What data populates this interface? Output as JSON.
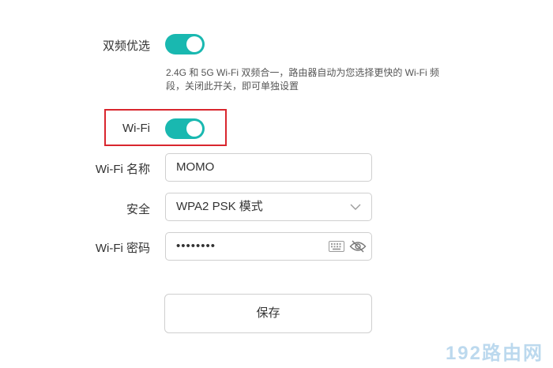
{
  "dual_band": {
    "label": "双频优选",
    "enabled": true,
    "hint": "2.4G 和 5G Wi-Fi 双频合一，路由器自动为您选择更快的 Wi-Fi 频段，关闭此开关，即可单独设置"
  },
  "wifi": {
    "label": "Wi-Fi",
    "enabled": true
  },
  "ssid": {
    "label": "Wi-Fi 名称",
    "value": "MOMO"
  },
  "security": {
    "label": "安全",
    "selected": "WPA2 PSK 模式"
  },
  "password": {
    "label": "Wi-Fi 密码",
    "value": "••••••••"
  },
  "save_label": "保存",
  "watermark": "192路由网",
  "colors": {
    "toggle_on": "#19b8b0",
    "highlight": "#d9262e"
  }
}
